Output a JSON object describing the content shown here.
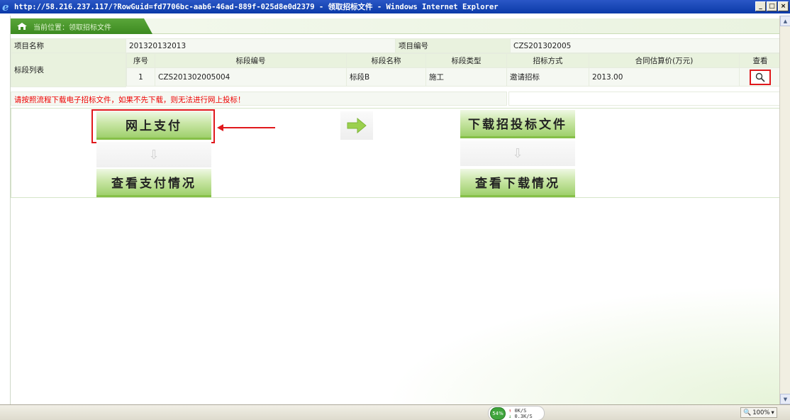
{
  "window": {
    "title": "http://58.216.237.117/?RowGuid=fd7706bc-aab6-46ad-889f-025d8e0d2379 - 领取招标文件 - Windows Internet Explorer",
    "min_label": "_",
    "max_label": "□",
    "close_label": "×"
  },
  "breadcrumb": {
    "text": "当前位置：领取招标文件"
  },
  "project": {
    "name_label": "项目名称",
    "name_value": "201320132013",
    "code_label": "项目编号",
    "code_value": "CZS201302005"
  },
  "sections": {
    "label": "标段列表",
    "headers": [
      "序号",
      "标段编号",
      "标段名称",
      "标段类型",
      "招标方式",
      "合同估算价(万元)",
      "查看"
    ],
    "rows": [
      {
        "index": "1",
        "code": "CZS201302005004",
        "name": "标段B",
        "type": "施工",
        "method": "邀请招标",
        "price": "2013.00"
      }
    ]
  },
  "notice": "请按照流程下载电子招标文件，如果不先下载，则无法进行网上投标！",
  "actions": {
    "pay_online": "网上支付",
    "view_payment": "查看支付情况",
    "download_docs": "下载招投标文件",
    "view_download": "查看下载情况"
  },
  "statusbar": {
    "cpu": "54%",
    "upload_rate": "0K/S",
    "download_rate": "0.3K/S",
    "zoom": "100%"
  },
  "colors": {
    "accent_green": "#5aa63a",
    "highlight_red": "#e0181c",
    "titlebar_blue": "#0b3aa8"
  }
}
